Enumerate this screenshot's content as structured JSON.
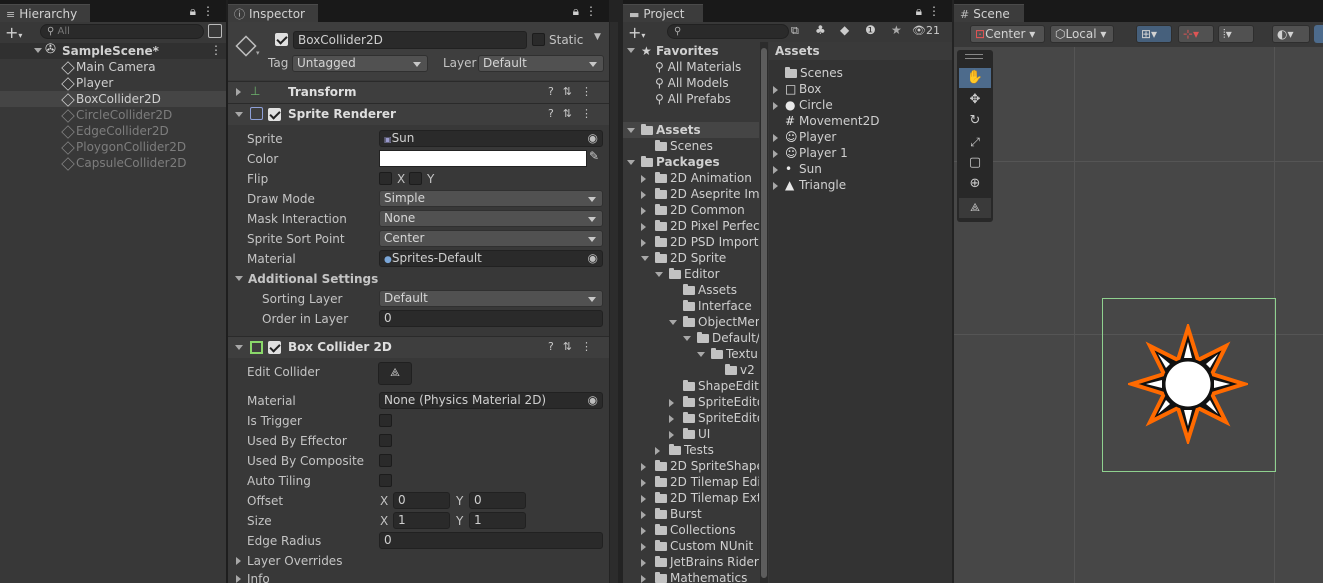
{
  "hierarchy": {
    "tab": "Hierarchy",
    "search_placeholder": "All",
    "scene": "SampleScene*",
    "items": [
      {
        "label": "Main Camera"
      },
      {
        "label": "Player"
      },
      {
        "label": "BoxCollider2D"
      },
      {
        "label": "CircleCollider2D"
      },
      {
        "label": "EdgeCollider2D"
      },
      {
        "label": "PloygonCollider2D"
      },
      {
        "label": "CapsuleCollider2D"
      }
    ]
  },
  "inspector": {
    "tab": "Inspector",
    "object_name": "BoxCollider2D",
    "static_label": "Static",
    "tag_label": "Tag",
    "tag_value": "Untagged",
    "layer_label": "Layer",
    "layer_value": "Default",
    "transform": "Transform",
    "sprite_renderer": {
      "title": "Sprite Renderer",
      "sprite_label": "Sprite",
      "sprite_value": "Sun",
      "color_label": "Color",
      "flip_label": "Flip",
      "flip_x": "X",
      "flip_y": "Y",
      "draw_mode_label": "Draw Mode",
      "draw_mode_value": "Simple",
      "mask_label": "Mask Interaction",
      "mask_value": "None",
      "sort_point_label": "Sprite Sort Point",
      "sort_point_value": "Center",
      "material_label": "Material",
      "material_value": "Sprites-Default",
      "additional": "Additional Settings",
      "sorting_layer_label": "Sorting Layer",
      "sorting_layer_value": "Default",
      "order_label": "Order in Layer",
      "order_value": "0"
    },
    "box_collider": {
      "title": "Box Collider 2D",
      "edit_label": "Edit Collider",
      "material_label": "Material",
      "material_value": "None (Physics Material 2D)",
      "trigger_label": "Is Trigger",
      "effector_label": "Used By Effector",
      "composite_label": "Used By Composite",
      "tiling_label": "Auto Tiling",
      "offset_label": "Offset",
      "offset_x": "0",
      "offset_y": "0",
      "size_label": "Size",
      "size_x": "1",
      "size_y": "1",
      "x_label": "X",
      "y_label": "Y",
      "radius_label": "Edge Radius",
      "radius_value": "0",
      "layer_overrides": "Layer Overrides",
      "info": "Info"
    }
  },
  "project": {
    "tab": "Project",
    "hidden_count": "21",
    "favorites": "Favorites",
    "fav_items": [
      "All Materials",
      "All Models",
      "All Prefabs"
    ],
    "assets_label": "Assets",
    "scenes_label": "Scenes",
    "packages_label": "Packages",
    "package_items": [
      "2D Animation",
      "2D Aseprite Imp",
      "2D Common",
      "2D Pixel Perfec",
      "2D PSD Importe",
      "2D Sprite",
      "Editor",
      "Assets",
      "Interface",
      "ObjectMen",
      "Default/",
      "Textu",
      "v2",
      "ShapeEdit",
      "SpriteEdito",
      "SpriteEdito",
      "UI",
      "Tests",
      "2D SpriteShape",
      "2D Tilemap Edit",
      "2D Tilemap Extr",
      "Burst",
      "Collections",
      "Custom NUnit",
      "JetBrains Rider",
      "Mathematics"
    ],
    "right_header": "Assets",
    "right_items": [
      "Scenes",
      "Box",
      "Circle",
      "Movement2D",
      "Player",
      "Player 1",
      "Sun",
      "Triangle"
    ]
  },
  "scene": {
    "tab": "Scene",
    "pivot": "Center",
    "space": "Local"
  },
  "colors": {
    "collider": "#8fd18f",
    "sun_outline": "#ff6a00"
  }
}
